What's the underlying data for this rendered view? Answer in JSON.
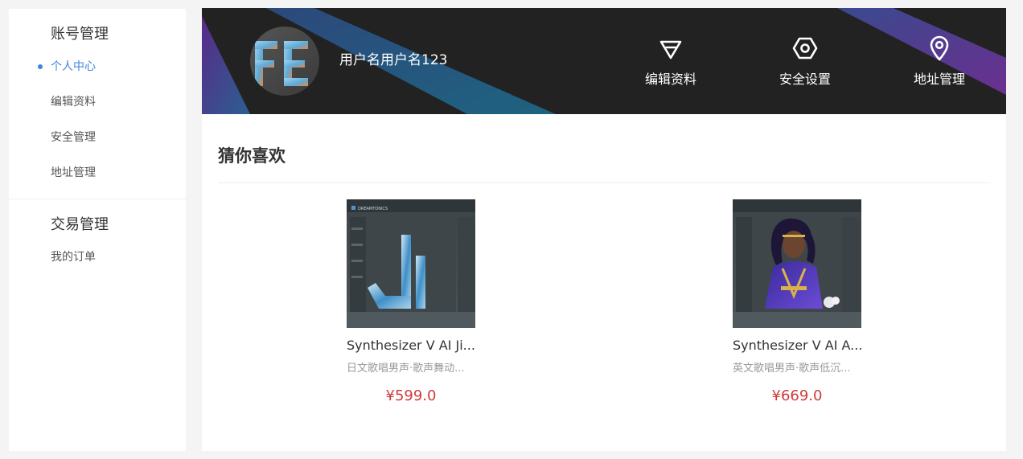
{
  "sidebar": {
    "account_section": {
      "title": "账号管理",
      "items": [
        {
          "label": "个人中心",
          "active": true
        },
        {
          "label": "编辑资料",
          "active": false
        },
        {
          "label": "安全管理",
          "active": false
        },
        {
          "label": "地址管理",
          "active": false
        }
      ]
    },
    "trade_section": {
      "title": "交易管理",
      "items": [
        {
          "label": "我的订单",
          "active": false
        }
      ]
    }
  },
  "banner": {
    "username": "用户名用户名123",
    "avatar_text": "FE",
    "actions": [
      {
        "label": "编辑资料",
        "icon": "gem-icon"
      },
      {
        "label": "安全设置",
        "icon": "hexagon-nut-icon"
      },
      {
        "label": "地址管理",
        "icon": "location-pin-icon"
      }
    ]
  },
  "recommendations": {
    "title": "猜你喜欢",
    "products": [
      {
        "name": "Synthesizer V AI Ji...",
        "desc": "日文歌唱男声·歌声舞动...",
        "price": "¥599.0",
        "thumb_text": "DREAMTONICS"
      },
      {
        "name": "Synthesizer V AI A...",
        "desc": "英文歌唱男声·歌声低沉...",
        "price": "¥669.0",
        "thumb_text": ""
      }
    ]
  },
  "colors": {
    "accent": "#3b86e0",
    "price": "#d03a3a",
    "banner_bg": "#222222"
  }
}
